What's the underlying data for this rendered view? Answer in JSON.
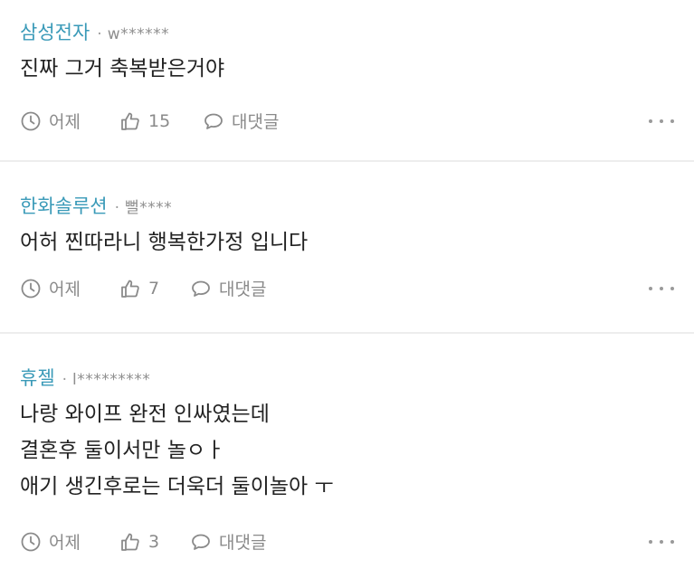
{
  "comments": [
    {
      "company": "삼성전자",
      "user": "w******",
      "lines": [
        "진짜 그거 축복받은거야"
      ],
      "time": "어제",
      "likes": "15",
      "reply_label": "대댓글"
    },
    {
      "company": "한화솔루션",
      "user": "뻘****",
      "lines": [
        "어허 찐따라니 행복한가정 입니다"
      ],
      "time": "어제",
      "likes": "7",
      "reply_label": "대댓글"
    },
    {
      "company": "휴젤",
      "user": "l*********",
      "lines": [
        "나랑 와이프 완전 인싸였는데",
        "결혼후 둘이서만 놀ㅇㅏ",
        "애기 생긴후로는 더욱더 둘이놀아 ㅜ"
      ],
      "time": "어제",
      "likes": "3",
      "reply_label": "대댓글"
    }
  ],
  "separator": "·",
  "icons": {
    "time": "clock-icon",
    "like": "thumbs-up-icon",
    "reply": "speech-bubble-icon",
    "more": "more-horizontal-icon"
  },
  "colors": {
    "company": "#3a9ab8",
    "meta": "#8a8a8a",
    "text": "#222222"
  }
}
